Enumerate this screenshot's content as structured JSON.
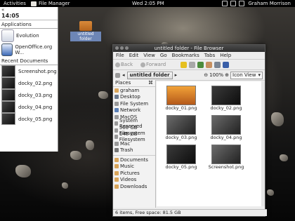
{
  "topbar": {
    "activities": "Activities",
    "app_menu": "File Manager",
    "clock": "Wed  2:05 PM",
    "user": "Graham Morrison"
  },
  "shell": {
    "back": "«",
    "time": "14:05",
    "applications_header": "Applications",
    "apps": [
      {
        "label": "Evolution"
      },
      {
        "label": "OpenOffice.org W..."
      }
    ],
    "recent_header": "Recent Documents",
    "docs": [
      "Screenshot.png",
      "docky_02.png",
      "docky_03.png",
      "docky_04.png",
      "docky_05.png"
    ]
  },
  "desktop": {
    "folder_label": "untitled folder"
  },
  "window": {
    "title": "untitled folder - File Browser",
    "menu": [
      "File",
      "Edit",
      "View",
      "Go",
      "Bookmarks",
      "Tabs",
      "Help"
    ],
    "toolbar": {
      "back": "Back",
      "forward": "Forward"
    },
    "location": "untitled folder",
    "zoom": "100%",
    "view_mode": "Icon View",
    "sidebar_header": "Places",
    "places": [
      "graham",
      "Desktop",
      "File System",
      "Network",
      "MacOS",
      "System Reserved",
      "500 GB Filesystem",
      "148 GB Filesystem",
      "Mac",
      "Trash"
    ],
    "places2": [
      "Documents",
      "Music",
      "Pictures",
      "Videos",
      "Downloads"
    ],
    "files": [
      "docky_01.png",
      "docky_02.png",
      "docky_03.png",
      "docky_04.png",
      "docky_05.png",
      "Screenshot.png"
    ],
    "status": "6 items, Free space: 81.5 GB"
  }
}
